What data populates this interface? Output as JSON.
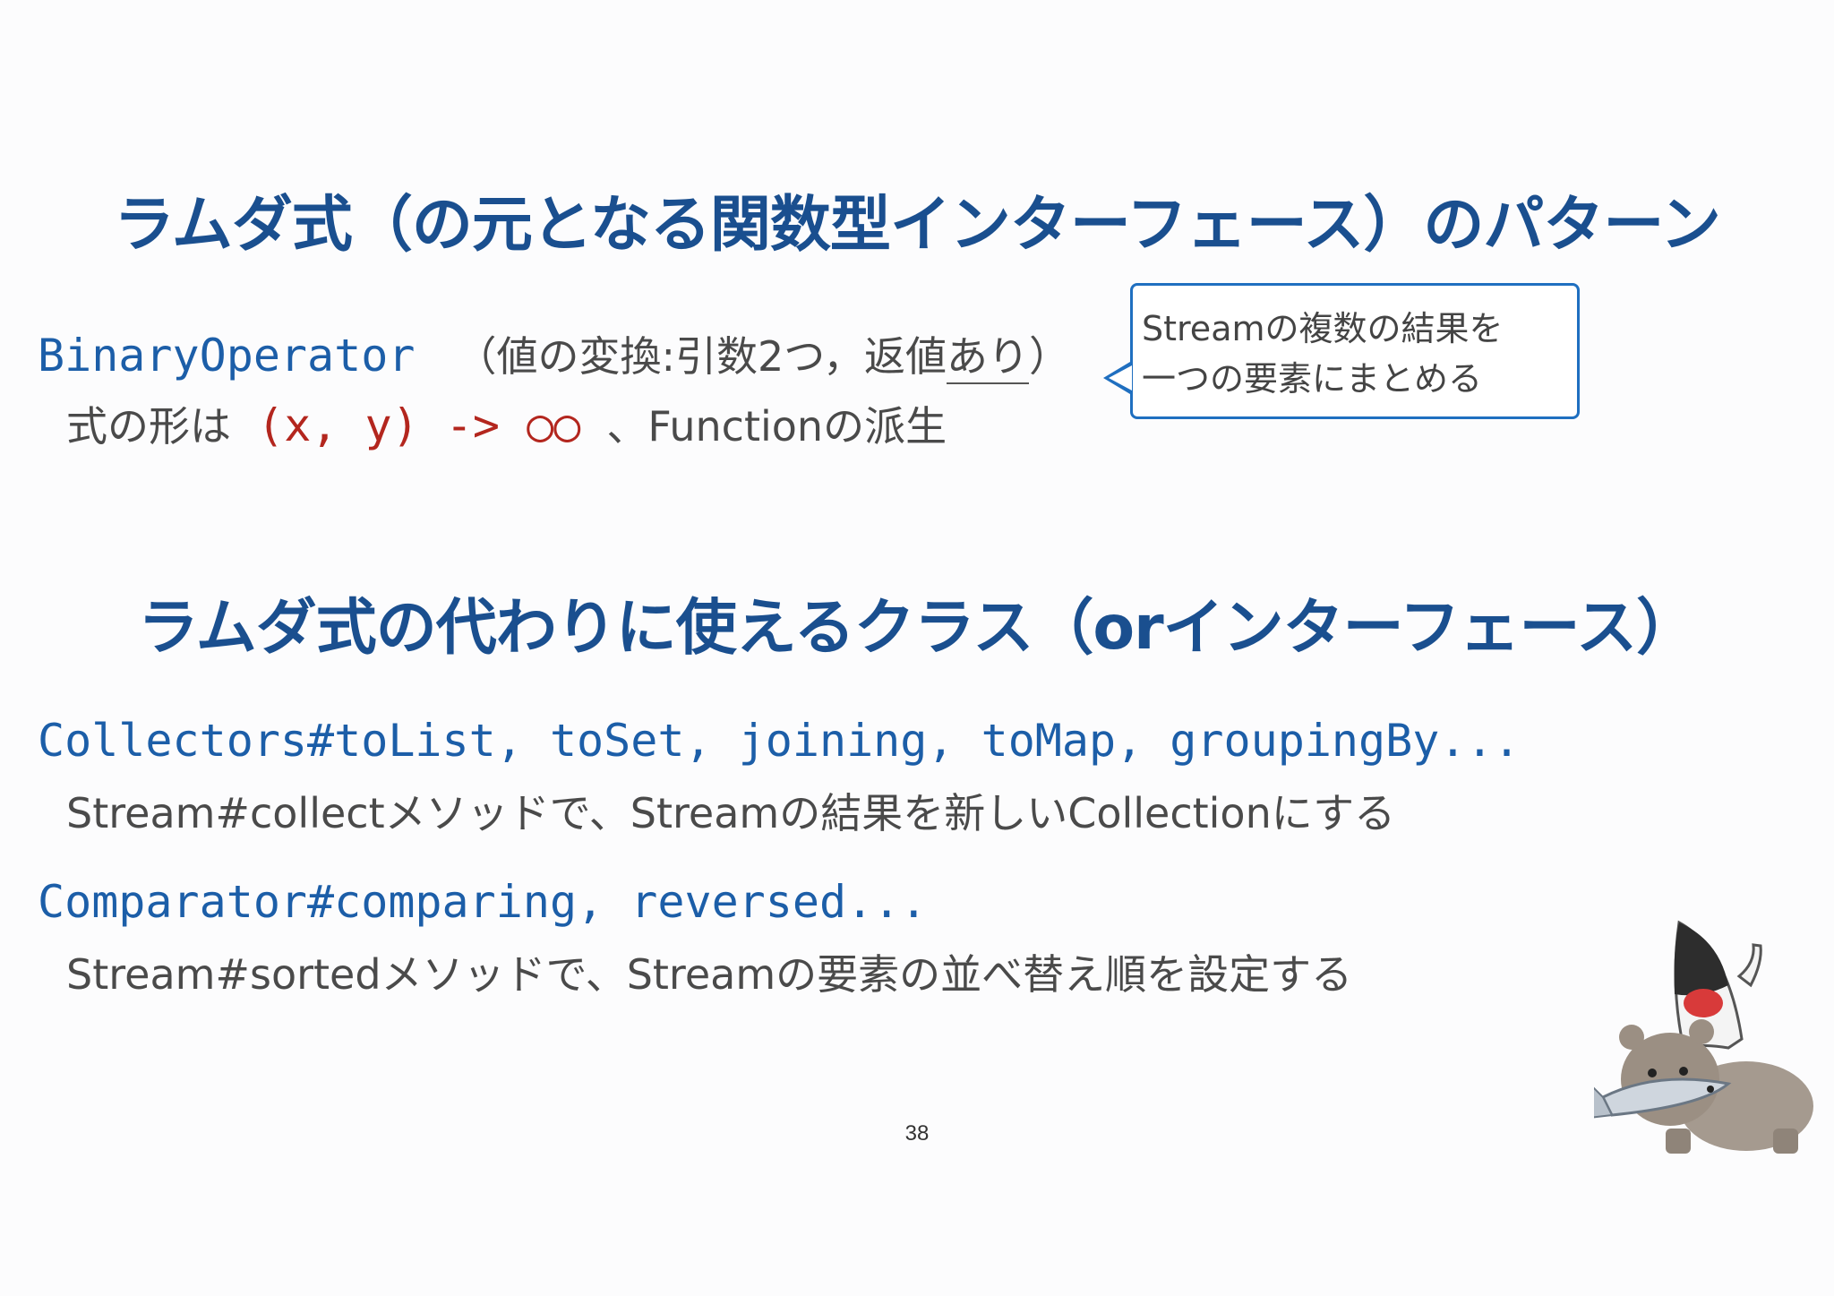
{
  "slide": {
    "title1": "ラムダ式（の元となる関数型インターフェース）のパターン",
    "binary_operator": {
      "code": "BinaryOperator",
      "note_prefix": "（値の変換:引数2つ，返値",
      "note_underlined": "あり",
      "note_suffix": "）",
      "form_label": "式の形は",
      "form_code": "(x, y) -> ○○",
      "form_suffix": "、Functionの派生"
    },
    "callout": {
      "line1": "Streamの複数の結果を",
      "line2": "一つの要素にまとめる"
    },
    "title2": "ラムダ式の代わりに使えるクラス（orインターフェース）",
    "collectors": {
      "code": "Collectors#toList, toSet, joining, toMap, groupingBy...",
      "desc": "Stream#collectメソッドで、Streamの結果を新しいCollectionにする"
    },
    "comparator": {
      "code": "Comparator#comparing, reversed...",
      "desc": "Stream#sortedメソッドで、Streamの要素の並べ替え順を設定する"
    },
    "page_number": "38"
  },
  "colors": {
    "title": "#1a4f8f",
    "code": "#1c5ea8",
    "red_code": "#b3261e",
    "text": "#4a4a4a",
    "callout_border": "#1f6fc0"
  },
  "icons": {
    "mascot": "bear-with-fish-and-duke-mascot"
  }
}
